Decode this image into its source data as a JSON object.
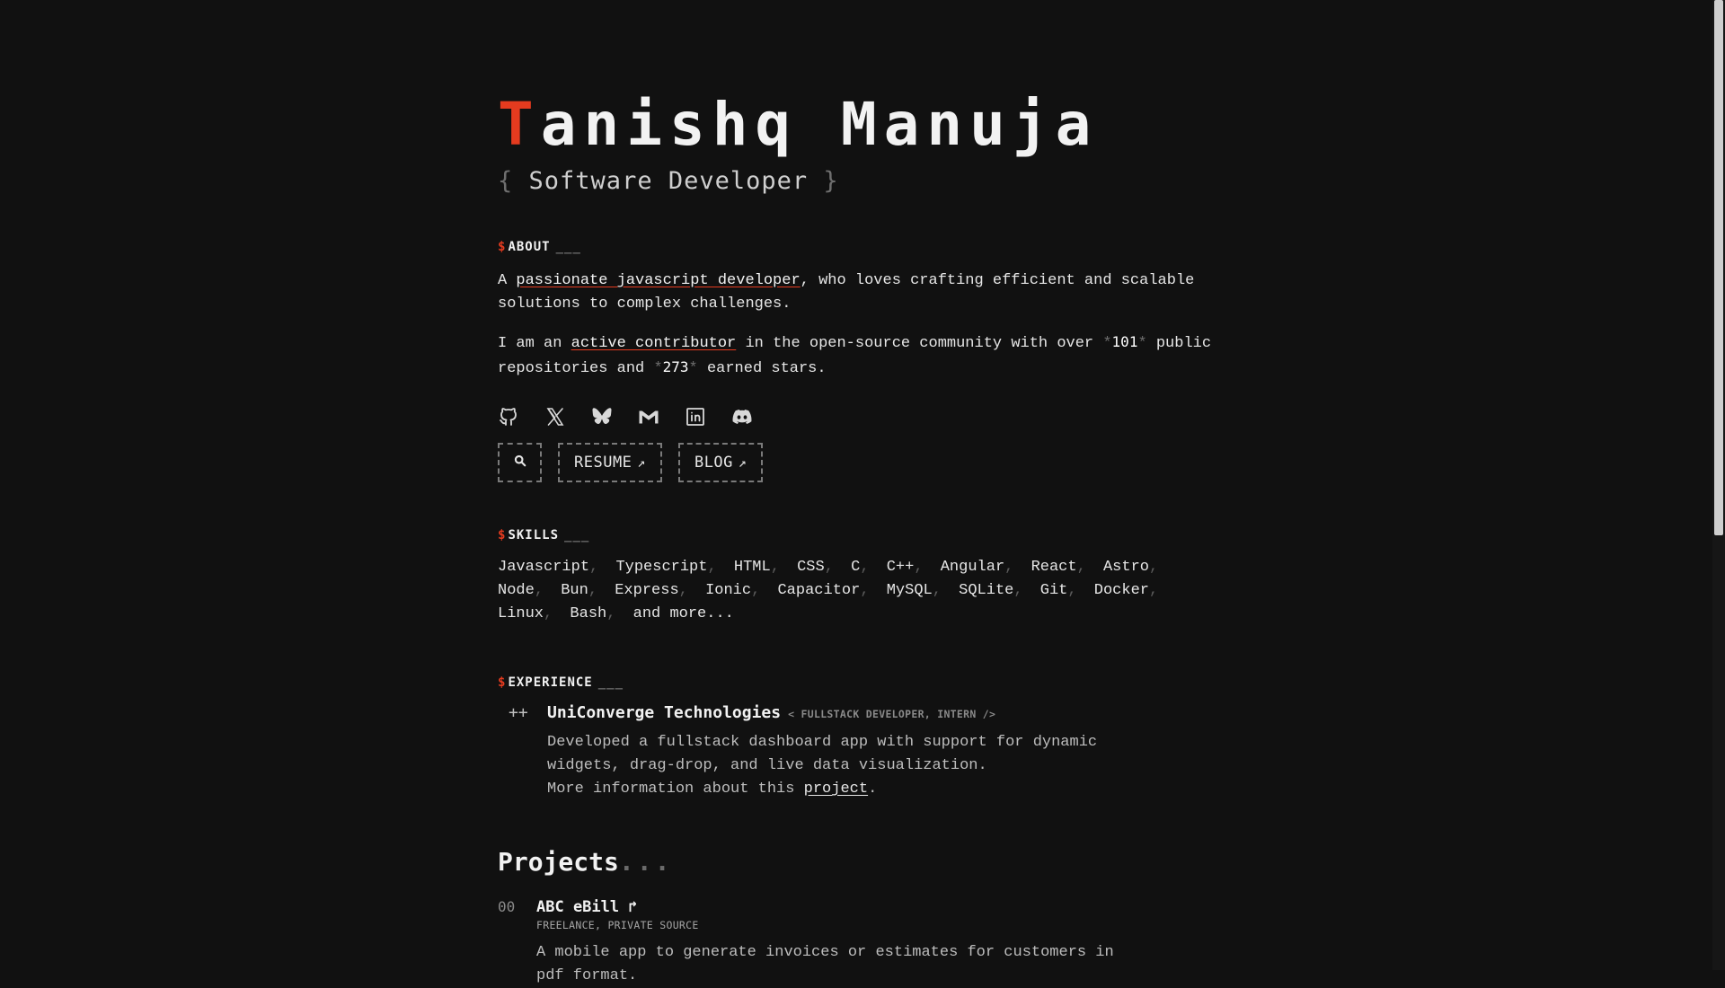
{
  "header": {
    "name_first": "T",
    "name_rest": "anishq Manuja",
    "role_open": "{",
    "role": "Software Developer",
    "role_close": "}"
  },
  "about": {
    "prompt": "$",
    "title": "ABOUT",
    "underscores": "___",
    "p1_a": "A ",
    "p1_link": "passionate javascript developer",
    "p1_b": ", who loves crafting efficient and scalable solutions to complex challenges.",
    "p2_a": "I am an ",
    "p2_link": "active contributor",
    "p2_b": " in the open-source community with over ",
    "repos": "101",
    "p2_c": " public repositories and ",
    "stars": "273",
    "p2_d": " earned stars.",
    "star_mark": "*"
  },
  "socials": [
    "github-icon",
    "x-icon",
    "bluesky-icon",
    "gmail-icon",
    "linkedin-icon",
    "discord-icon"
  ],
  "actions": {
    "resume": "RESUME",
    "blog": "BLOG",
    "arrow": "↗"
  },
  "skills": {
    "prompt": "$",
    "title": "SKILLS",
    "underscores": "___",
    "items": [
      "Javascript",
      "Typescript",
      "HTML",
      "CSS",
      "C",
      "C++",
      "Angular",
      "React",
      "Astro",
      "Node",
      "Bun",
      "Express",
      "Ionic",
      "Capacitor",
      "MySQL",
      "SQLite",
      "Git",
      "Docker",
      "Linux",
      "Bash"
    ],
    "more": "and more..."
  },
  "experience": {
    "prompt": "$",
    "title": "EXPERIENCE",
    "underscores": "___",
    "items": [
      {
        "marker": "++",
        "company": "UniConverge Technologies",
        "tag": "< FULLSTACK DEVELOPER, INTERN />",
        "desc": "Developed a fullstack dashboard app with support for dynamic widgets, drag-drop, and live data visualization.",
        "more_a": "More information about this ",
        "more_link": "project",
        "more_b": "."
      }
    ]
  },
  "projects": {
    "title": "Projects",
    "dots": "...",
    "items": [
      {
        "num": "00",
        "title": "ABC eBill ↱",
        "tag": "FREELANCE, PRIVATE SOURCE",
        "desc": "A mobile app to generate invoices or estimates for customers in pdf format."
      }
    ]
  }
}
